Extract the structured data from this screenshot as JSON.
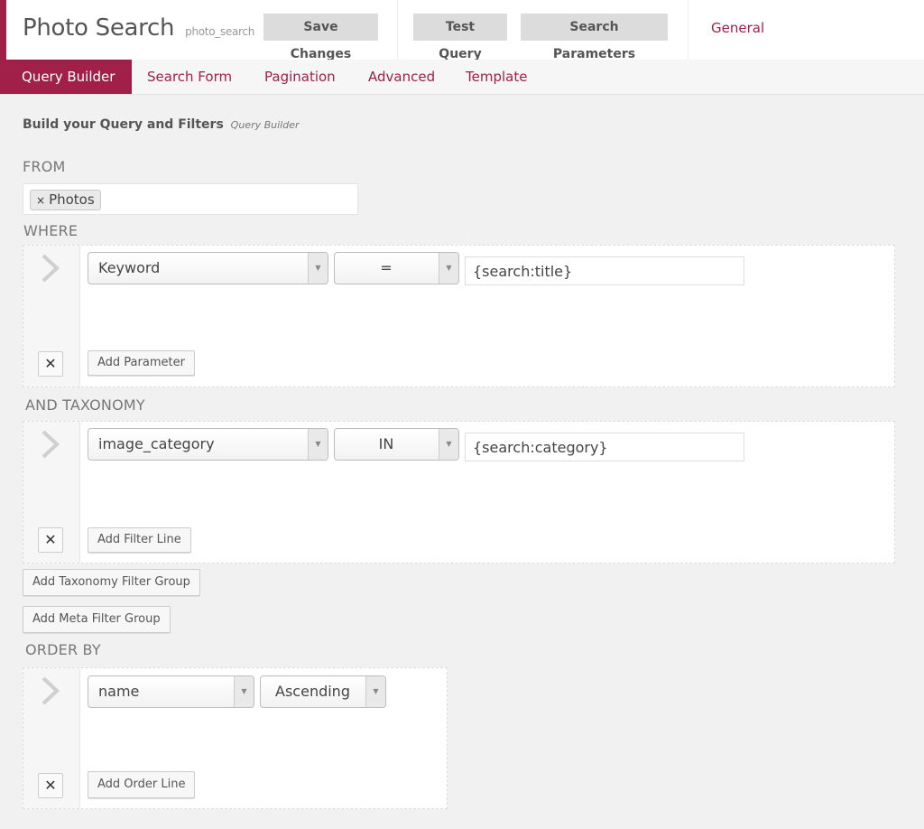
{
  "header": {
    "title": "Photo Search",
    "slug": "photo_search",
    "buttons": {
      "save": "Save Changes",
      "test": "Test Query",
      "params": "Search Parameters"
    },
    "general_link": "General"
  },
  "tabs": [
    {
      "label": "Query Builder",
      "active": true
    },
    {
      "label": "Search Form",
      "active": false
    },
    {
      "label": "Pagination",
      "active": false
    },
    {
      "label": "Advanced",
      "active": false
    },
    {
      "label": "Template",
      "active": false
    }
  ],
  "colors": {
    "accent": "#a0204a",
    "background": "#f1f1f1"
  },
  "content": {
    "title": "Build your Query and Filters",
    "subtitle": "Query Builder",
    "from": {
      "label": "FROM",
      "chips": [
        {
          "label": "Photos",
          "remove_icon": "×"
        }
      ]
    },
    "where": {
      "label": "WHERE",
      "rows": [
        {
          "field": "Keyword",
          "operator": "=",
          "value": "{search:title}"
        }
      ],
      "add_button": "Add Parameter",
      "delete_icon": "✕"
    },
    "taxonomy": {
      "label": "AND TAXONOMY",
      "rows": [
        {
          "field": "image_category",
          "operator": "IN",
          "value": "{search:category}"
        }
      ],
      "add_button": "Add Filter Line",
      "delete_icon": "✕"
    },
    "add_taxonomy_group": "Add Taxonomy Filter Group",
    "add_meta_group": "Add Meta Filter Group",
    "order_by": {
      "label": "ORDER BY",
      "rows": [
        {
          "field": "name",
          "direction": "Ascending"
        }
      ],
      "add_button": "Add Order Line",
      "delete_icon": "✕"
    }
  },
  "icons": {
    "dropdown_arrow": "▼",
    "drag_handle": "chevron-right"
  }
}
